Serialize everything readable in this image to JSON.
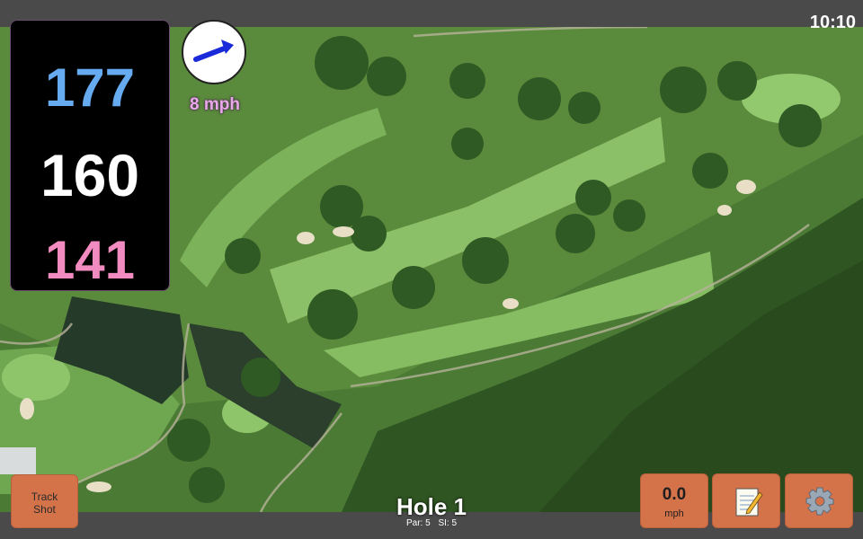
{
  "status_bar": {
    "time": "10:10"
  },
  "yardages": {
    "back": "177",
    "middle": "160",
    "front": "141"
  },
  "wind": {
    "speed_label": "8 mph",
    "icon": "arrow-right-icon"
  },
  "hole": {
    "title": "Hole 1",
    "par_label": "Par: 5",
    "si_label": "SI: 5"
  },
  "buttons": {
    "track_shot_line1": "Track",
    "track_shot_line2": "Shot",
    "speed_value": "0.0",
    "speed_unit": "mph",
    "notes_icon": "notepad-icon",
    "settings_icon": "gear-icon"
  },
  "colors": {
    "back_yardage": "#66aaf0",
    "middle_yardage": "#ffffff",
    "front_yardage": "#f28cc0",
    "button_accent": "#d4734a",
    "wind_text": "#e8a8ea"
  }
}
